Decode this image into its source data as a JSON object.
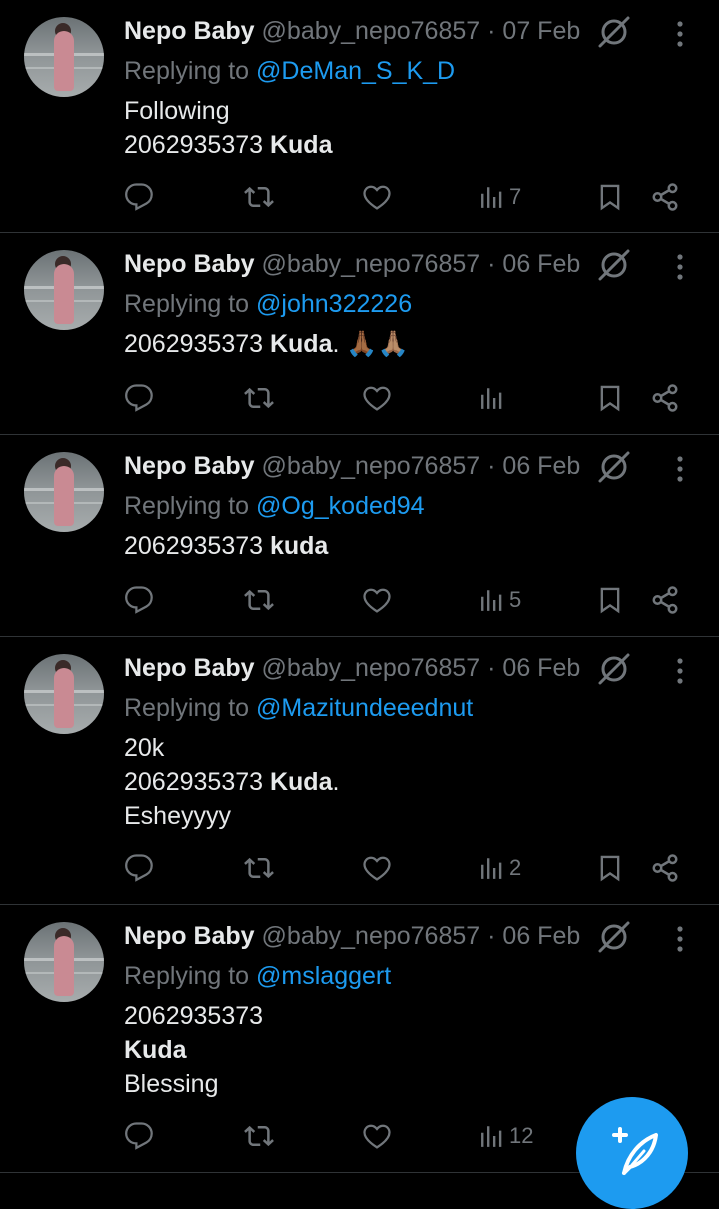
{
  "tweets": [
    {
      "name": "Nepo Baby",
      "handle": "@baby_nepo76857",
      "separator": "·",
      "date": "07 Feb",
      "replying_prefix": "Replying to",
      "replying_to": "@DeMan_S_K_D",
      "lines": [
        {
          "text": "Following",
          "bold": ""
        },
        {
          "text": "2062935373 ",
          "bold": "Kuda"
        }
      ],
      "views": "7"
    },
    {
      "name": "Nepo Baby",
      "handle": "@baby_nepo76857",
      "separator": "·",
      "date": "06 Feb",
      "replying_prefix": "Replying to",
      "replying_to": "@john322226",
      "lines": [
        {
          "text": "2062935373 ",
          "bold": "Kuda",
          "suffix": ". 🙏🏾🙏🏽"
        }
      ],
      "views": ""
    },
    {
      "name": "Nepo Baby",
      "handle": "@baby_nepo76857",
      "separator": "·",
      "date": "06 Feb",
      "replying_prefix": "Replying to",
      "replying_to": "@Og_koded94",
      "lines": [
        {
          "text": "2062935373 ",
          "bold": "kuda"
        }
      ],
      "views": "5"
    },
    {
      "name": "Nepo Baby",
      "handle": "@baby_nepo76857",
      "separator": "·",
      "date": "06 Feb",
      "replying_prefix": "Replying to",
      "replying_to": "@Mazitundeeednut",
      "lines": [
        {
          "text": "20k",
          "bold": ""
        },
        {
          "text": "2062935373 ",
          "bold": "Kuda",
          "suffix": "."
        },
        {
          "text": "Esheyyyy",
          "bold": ""
        }
      ],
      "views": "2"
    },
    {
      "name": "Nepo Baby",
      "handle": "@baby_nepo76857",
      "separator": "·",
      "date": "06 Feb",
      "replying_prefix": "Replying to",
      "replying_to": "@mslaggert",
      "lines": [
        {
          "text": "2062935373",
          "bold": ""
        },
        {
          "text": "",
          "bold": "Kuda"
        },
        {
          "text": "Blessing",
          "bold": ""
        }
      ],
      "views": "12"
    }
  ],
  "icons": {
    "reply": "reply-icon",
    "retweet": "retweet-icon",
    "like": "heart-icon",
    "views": "analytics-icon",
    "bookmark": "bookmark-icon",
    "share": "share-icon",
    "grok": "grok-icon",
    "more": "more-icon",
    "compose": "compose-icon"
  },
  "colors": {
    "background": "#000000",
    "text": "#e7e9ea",
    "muted": "#71767b",
    "accent": "#1d9bf0",
    "divider": "#2f3336"
  }
}
